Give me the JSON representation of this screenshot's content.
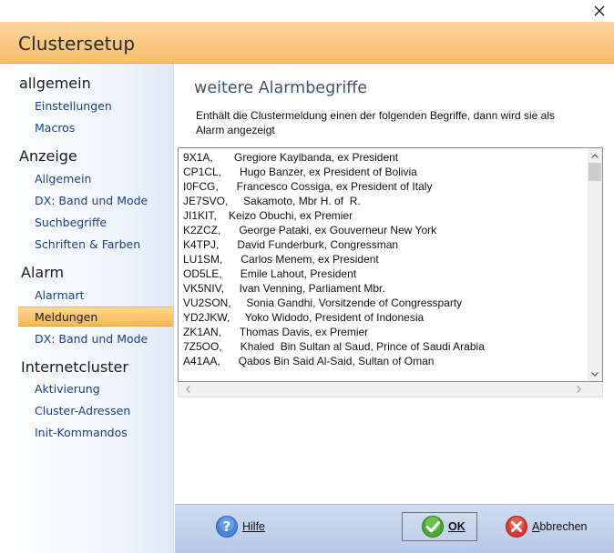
{
  "window": {
    "title": "Clustersetup"
  },
  "sidebar": {
    "groups": [
      {
        "title": "allgemein",
        "items": [
          "Einstellungen",
          "Macros"
        ]
      },
      {
        "title": "Anzeige",
        "items": [
          "Allgemein",
          "DX: Band und Mode",
          "Suchbegriffe",
          "Schriften & Farben"
        ]
      },
      {
        "title": "Alarm",
        "items": [
          "Alarmart",
          "Meldungen",
          "DX: Band und Mode"
        ]
      },
      {
        "title": "Internetcluster",
        "items": [
          "Aktivierung",
          "Cluster-Adressen",
          "Init-Kommandos"
        ]
      }
    ],
    "selected": "Meldungen"
  },
  "content": {
    "title": "weitere Alarmbegriffe",
    "description": "Enthält die Clustermeldung einen der folgenden Begriffe, dann wird sie als Alarm angezeigt",
    "entries": [
      "9X1A,       Gregiore Kaylbanda, ex President",
      "CP1CL,      Hugo Banzer, ex President of Bolivia",
      "I0FCG,      Francesco Cossiga, ex President of Italy",
      "JE7SVO,     Sakamoto, Mbr H. of  R.",
      "JI1KIT,    Keizo Obuchi, ex Premier",
      "K2ZCZ,      George Pataki, ex Gouverneur New York",
      "K4TPJ,      David Funderburk, Congressman",
      "LU1SM,      Carlos Menem, ex President",
      "OD5LE,      Emile Lahout, President",
      "VK5NIV,     Ivan Venning, Parliament Mbr.",
      "VU2SON,     Sonia Gandhi, Vorsitzende of Congressparty",
      "YD2JKW,     Yoko Widodo, President of Indonesia",
      "ZK1AN,      Thomas Davis, ex Premier",
      "7Z5OO,      Khaled  Bin Sultan al Saud, Prince of Saudi Arabia",
      "A41AA,      Qabos Bin Said Al-Said, Sultan of Oman"
    ]
  },
  "footer": {
    "help_label": "Hilfe",
    "ok_label": "OK",
    "cancel_label": "Abbrechen"
  },
  "colors": {
    "header": "#f6bd6c",
    "selected": "#f8b955",
    "link": "#1a3f84",
    "footer": "#c3d3ec"
  }
}
